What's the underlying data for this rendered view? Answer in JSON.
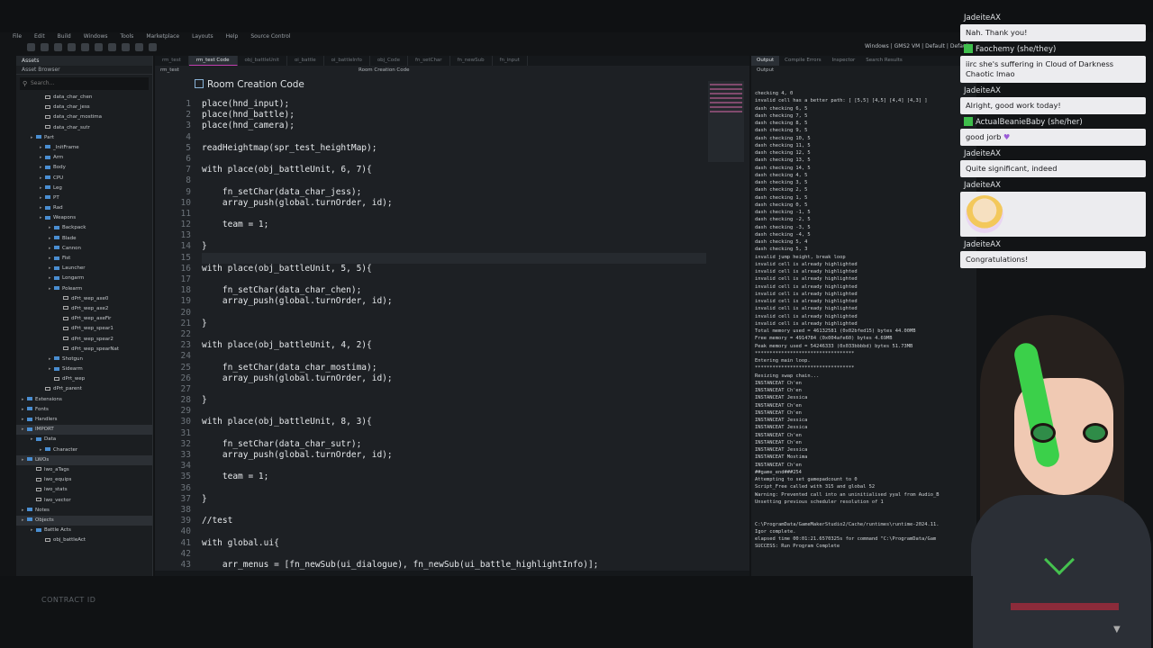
{
  "menu": [
    "File",
    "Edit",
    "Build",
    "Windows",
    "Tools",
    "Marketplace",
    "Layouts",
    "Help",
    "Source Control"
  ],
  "top_right": "Windows | GMS2 VM | Default | Default",
  "assets": {
    "tab": "Assets",
    "title": "Asset Browser",
    "search_placeholder": "Search...",
    "tree": [
      {
        "label": "data_char_chen",
        "depth": 2
      },
      {
        "label": "data_char_jess",
        "depth": 2
      },
      {
        "label": "data_char_mostima",
        "depth": 2
      },
      {
        "label": "data_char_sutr",
        "depth": 2
      },
      {
        "label": "Part",
        "depth": 1,
        "folder": true
      },
      {
        "label": "_InitFrame",
        "depth": 2,
        "folder": true
      },
      {
        "label": "Arm",
        "depth": 2,
        "folder": true
      },
      {
        "label": "Body",
        "depth": 2,
        "folder": true
      },
      {
        "label": "CPU",
        "depth": 2,
        "folder": true
      },
      {
        "label": "Leg",
        "depth": 2,
        "folder": true
      },
      {
        "label": "PT",
        "depth": 2,
        "folder": true
      },
      {
        "label": "Rad",
        "depth": 2,
        "folder": true
      },
      {
        "label": "Weapons",
        "depth": 2,
        "folder": true
      },
      {
        "label": "Backpack",
        "depth": 3,
        "folder": true
      },
      {
        "label": "Blade",
        "depth": 3,
        "folder": true
      },
      {
        "label": "Cannon",
        "depth": 3,
        "folder": true
      },
      {
        "label": "Fist",
        "depth": 3,
        "folder": true
      },
      {
        "label": "Launcher",
        "depth": 3,
        "folder": true
      },
      {
        "label": "Longarm",
        "depth": 3,
        "folder": true
      },
      {
        "label": "Polearm",
        "depth": 3,
        "folder": true
      },
      {
        "label": "dPrt_wep_axe0",
        "depth": 4
      },
      {
        "label": "dPrt_wep_axe2",
        "depth": 4
      },
      {
        "label": "dPrt_wep_axeFir",
        "depth": 4
      },
      {
        "label": "dPrt_wep_spear1",
        "depth": 4
      },
      {
        "label": "dPrt_wep_spear2",
        "depth": 4
      },
      {
        "label": "dPrt_wep_spearNat",
        "depth": 4
      },
      {
        "label": "Shotgun",
        "depth": 3,
        "folder": true
      },
      {
        "label": "Sidearm",
        "depth": 3,
        "folder": true
      },
      {
        "label": "dPrt_wep",
        "depth": 3
      },
      {
        "label": "dPrt_parent",
        "depth": 2
      },
      {
        "label": "Extensions",
        "depth": 0,
        "folder": true
      },
      {
        "label": "Fonts",
        "depth": 0,
        "folder": true
      },
      {
        "label": "Handlers",
        "depth": 0,
        "folder": true
      },
      {
        "label": "IMPORT",
        "depth": 0,
        "folder": true,
        "section": true
      },
      {
        "label": "Data",
        "depth": 1,
        "folder": true
      },
      {
        "label": "Character",
        "depth": 2,
        "folder": true
      },
      {
        "label": "LWOs",
        "depth": 0,
        "folder": true,
        "section": true
      },
      {
        "label": "lwo_aTags",
        "depth": 1
      },
      {
        "label": "lwo_equips",
        "depth": 1
      },
      {
        "label": "lwo_stats",
        "depth": 1
      },
      {
        "label": "lwo_vector",
        "depth": 1
      },
      {
        "label": "Notes",
        "depth": 0,
        "folder": true
      },
      {
        "label": "Objects",
        "depth": 0,
        "folder": true,
        "section": true
      },
      {
        "label": "Battle Acts",
        "depth": 1,
        "folder": true
      },
      {
        "label": "obj_battleAct",
        "depth": 2
      }
    ]
  },
  "editor": {
    "tabs": [
      "rm_test",
      "rm_test Code",
      "obj_battleUnit",
      "oi_battle",
      "oi_battleInfo",
      "obj_Code",
      "fn_setChar",
      "fn_newSub",
      "fn_input"
    ],
    "active_tab": 1,
    "sub_left": "rm_test",
    "sub_right": "Room Creation Code",
    "heading": "Room Creation Code",
    "line_numbers": [
      "1",
      "2",
      "3",
      "4",
      "5",
      "6",
      "7",
      "8",
      "9",
      "10",
      "11",
      "12",
      "13",
      "14",
      "15",
      "16",
      "17",
      "18",
      "19",
      "20",
      "21",
      "22",
      "23",
      "24",
      "25",
      "26",
      "27",
      "28",
      "29",
      "30",
      "31",
      "32",
      "33",
      "34",
      "35",
      "36",
      "37",
      "38",
      "39",
      "40",
      "41",
      "42",
      "43"
    ],
    "lines": [
      "place(hnd_input);",
      "place(hnd_battle);",
      "place(hnd_camera);",
      "",
      "readHeightmap(spr_test_heightMap);",
      "",
      "with place(obj_battleUnit, 6, 7){",
      "",
      "    fn_setChar(data_char_jess);",
      "    array_push(global.turnOrder, id);",
      "",
      "    team = 1;",
      "",
      "}",
      "",
      "with place(obj_battleUnit, 5, 5){",
      "",
      "    fn_setChar(data_char_chen);",
      "    array_push(global.turnOrder, id);",
      "",
      "}",
      "",
      "with place(obj_battleUnit, 4, 2){",
      "",
      "    fn_setChar(data_char_mostima);",
      "    array_push(global.turnOrder, id);",
      "",
      "}",
      "",
      "with place(obj_battleUnit, 8, 3){",
      "",
      "    fn_setChar(data_char_sutr);",
      "    array_push(global.turnOrder, id);",
      "",
      "    team = 1;",
      "",
      "}",
      "",
      "//test",
      "",
      "with global.ui{",
      "",
      "    arr_menus = [fn_newSub(ui_dialogue), fn_newSub(ui_battle_highlightInfo)];"
    ]
  },
  "output": {
    "tabs": [
      "Output",
      "Compile Errors",
      "Inspector",
      "Search Results"
    ],
    "title": "Output",
    "lines": [
      "checking 4, 0",
      "invalid cell has a better path: [ [5,5] [4,5] [4,4] [4,3] ]",
      "dash checking 6, 5",
      "dash checking 7, 5",
      "dash checking 8, 5",
      "dash checking 9, 5",
      "dash checking 10, 5",
      "dash checking 11, 5",
      "dash checking 12, 5",
      "dash checking 13, 5",
      "dash checking 14, 5",
      "dash checking 4, 5",
      "dash checking 3, 5",
      "dash checking 2, 5",
      "dash checking 1, 5",
      "dash checking 0, 5",
      "dash checking -1, 5",
      "dash checking -2, 5",
      "dash checking -3, 5",
      "dash checking -4, 5",
      "dash checking 5, 4",
      "dash checking 5, 3",
      "invalid jump height, break loop",
      "invalid cell is already highlighted",
      "invalid cell is already highlighted",
      "invalid cell is already highlighted",
      "invalid cell is already highlighted",
      "invalid cell is already highlighted",
      "invalid cell is already highlighted",
      "invalid cell is already highlighted",
      "invalid cell is already highlighted",
      "invalid cell is already highlighted",
      "Total memory used = 46132581 (0x02bfed15) bytes 44.00MB",
      "Free memory = 4914784 (0x004afe60) bytes 4.69MB",
      "Peak memory used = 54246333 (0x033bbbbd) bytes 51.73MB",
      "**********************************",
      "Entering main loop.",
      "**********************************",
      "Resizing swap chain...",
      "INSTANCEAT Ch'en",
      "INSTANCEAT Ch'en",
      "INSTANCEAT Jessica",
      "INSTANCEAT Ch'en",
      "INSTANCEAT Ch'en",
      "INSTANCEAT Jessica",
      "INSTANCEAT Jessica",
      "INSTANCEAT Ch'en",
      "INSTANCEAT Ch'en",
      "INSTANCEAT Jessica",
      "INSTANCEAT Mostima",
      "INSTANCEAT Ch'en",
      "##game_end###254",
      "Attempting to set gamepadcount to 0",
      "Script_Free called with 315 and global 52",
      "Warning: Prevented call into an uninitialised yyal from Audio_B",
      "Unsetting previous scheduler resolution of 1",
      "",
      "",
      "C:\\ProgramData/GameMakerStudio2/Cache/runtimes\\runtime-2024.11.",
      "Igor complete.",
      "elapsed time 00:01:21.6570325s for command \"C:\\ProgramData/Gam",
      "SUCCESS: Run Program Complete"
    ]
  },
  "chat": [
    {
      "user": "JadeiteAX",
      "badge": false,
      "text": "Nah. Thank you!"
    },
    {
      "user": "Faochemy (she/they)",
      "badge": true,
      "text": "iirc she's suffering in Cloud of Darkness Chaotic lmao"
    },
    {
      "user": "JadeiteAX",
      "badge": false,
      "text": "Alright, good work today!"
    },
    {
      "user": "ActualBeanieBaby (she/her)",
      "badge": true,
      "text": "good jorb",
      "heart": "♥"
    },
    {
      "user": "JadeiteAX",
      "badge": false,
      "text": "Quite significant, indeed"
    },
    {
      "user": "JadeiteAX",
      "badge": false,
      "emote": true,
      "emote_name": "chibi-emote"
    },
    {
      "user": "JadeiteAX",
      "badge": false,
      "text": "Congratulations!"
    }
  ],
  "overlay": {
    "contract": "CONTRACT ID"
  },
  "colors": {
    "accent_green": "#3fbe4c",
    "tab_underline": "#c23fb0",
    "folder": "#4a8ed1"
  }
}
